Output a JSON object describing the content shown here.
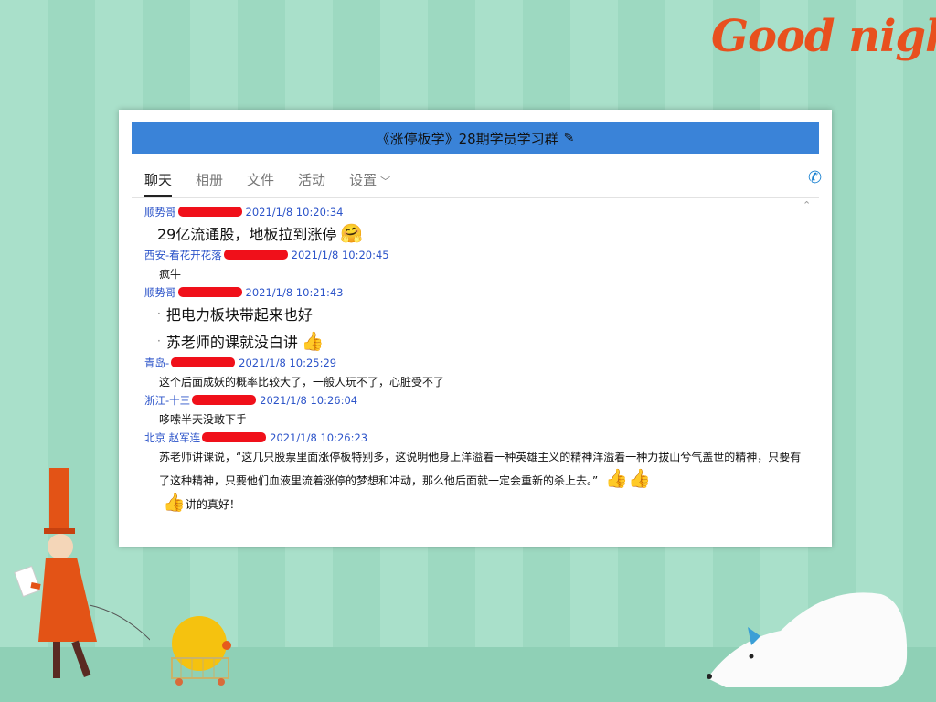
{
  "decor": {
    "goodnight_text": "Good night",
    "colors": {
      "background": "#a9e0ca",
      "accent": "#e8501e",
      "titlebar": "#3a83d8",
      "name": "#2b53c9",
      "redaction": "#f0101a"
    }
  },
  "window": {
    "title": "《涨停板学》28期学员学习群",
    "edit_icon": "pencil-icon",
    "call_icon": "phone-icon"
  },
  "tabs": [
    {
      "label": "聊天",
      "active": true
    },
    {
      "label": "相册"
    },
    {
      "label": "文件"
    },
    {
      "label": "活动"
    },
    {
      "label": "设置",
      "has_dropdown": true
    }
  ],
  "messages": [
    {
      "sender": "顺势哥",
      "time": "2021/1/8 10:20:34",
      "lines": [
        "29亿流通股，地板拉到涨停"
      ],
      "emoji": "hug-emoji"
    },
    {
      "sender": "西安-看花开花落",
      "time": "2021/1/8 10:20:45",
      "lines": [
        "疯牛"
      ]
    },
    {
      "sender": "顺势哥",
      "time": "2021/1/8 10:21:43",
      "lines": [
        "把电力板块带起来也好",
        "苏老师的课就没白讲"
      ],
      "emoji": "thumbs-up-emoji"
    },
    {
      "sender": "青岛-",
      "time": "2021/1/8 10:25:29",
      "lines": [
        "这个后面成妖的概率比较大了，一般人玩不了，心脏受不了"
      ]
    },
    {
      "sender": "浙江-十三",
      "time": "2021/1/8 10:26:04",
      "lines": [
        "哆嗦半天没敢下手"
      ]
    },
    {
      "sender": "北京  赵军连",
      "time": "2021/1/8 10:26:23",
      "lines": [
        "苏老师讲课说，“这几只股票里面涨停板特别多，这说明他身上洋溢着一种英雄主义的精神洋溢着一种力拔山兮气盖世的精神，只要有了这种精神，只要他们血液里流着涨停的梦想和冲动，那么他后面就一定会重新的杀上去。”",
        "讲的真好！"
      ],
      "emoji": "thumbs-up-emoji"
    }
  ]
}
